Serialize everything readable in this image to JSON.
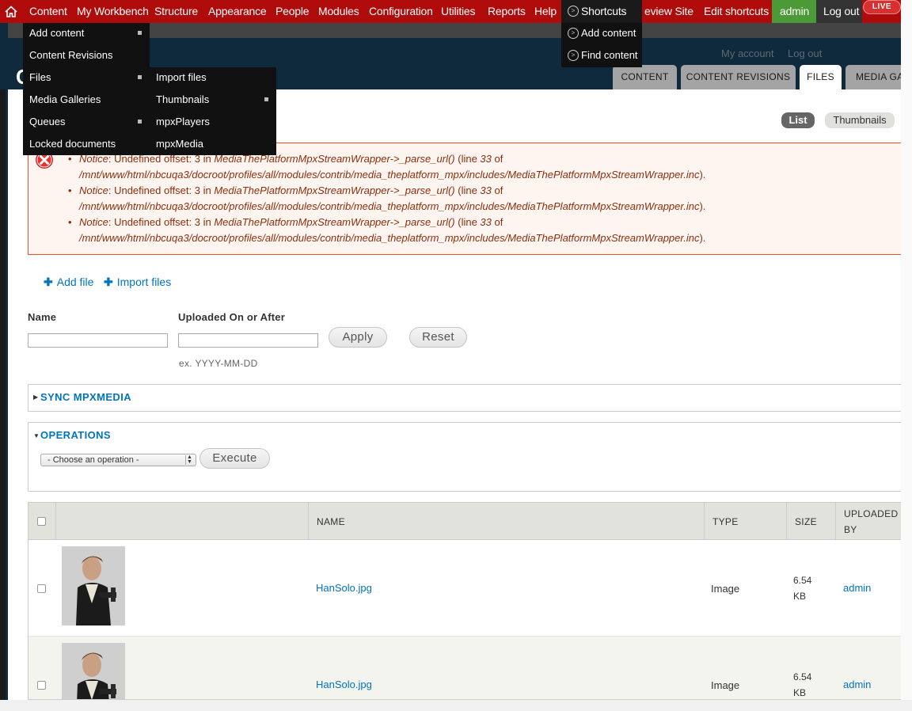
{
  "toolbar": {
    "items": [
      "Content",
      "My Workbench",
      "Structure",
      "Appearance",
      "People",
      "Modules",
      "Configuration",
      "Utilities",
      "Reports",
      "Help"
    ],
    "shortcuts_label": "Shortcuts",
    "preview_site": "eview Site",
    "edit_shortcuts": "Edit shortcuts",
    "user": "admin",
    "logout": "Log out",
    "live_badge": "LIVE"
  },
  "header": {
    "title_fragment": "C",
    "my_account": "My account",
    "log_out": "Log out"
  },
  "tabs": [
    "CONTENT",
    "CONTENT REVISIONS",
    "FILES",
    "MEDIA GA"
  ],
  "view_toggle": {
    "list": "List",
    "thumbnails": "Thumbnails"
  },
  "errors": [
    {
      "label": "Notice",
      "text": ": Undefined offset: 3 in ",
      "func": "MediaThePlatformMpxStreamWrapper->_parse_url()",
      "line_pre": " (line ",
      "line": "33",
      "line_post": " of",
      "path": "/mnt/www/html/nbcuqa3/docroot/profiles/all/modules/contrib/media_theplatform_mpx/includes/MediaThePlatformMpxStreamWrapper.inc",
      "end": ")."
    },
    {
      "label": "Notice",
      "text": ": Undefined offset: 3 in ",
      "func": "MediaThePlatformMpxStreamWrapper->_parse_url()",
      "line_pre": " (line ",
      "line": "33",
      "line_post": " of",
      "path": "/mnt/www/html/nbcuqa3/docroot/profiles/all/modules/contrib/media_theplatform_mpx/includes/MediaThePlatformMpxStreamWrapper.inc",
      "end": ")."
    },
    {
      "label": "Notice",
      "text": ": Undefined offset: 3 in ",
      "func": "MediaThePlatformMpxStreamWrapper->_parse_url()",
      "line_pre": " (line ",
      "line": "33",
      "line_post": " of",
      "path": "/mnt/www/html/nbcuqa3/docroot/profiles/all/modules/contrib/media_theplatform_mpx/includes/MediaThePlatformMpxStreamWrapper.inc",
      "end": ")."
    }
  ],
  "actions": {
    "add_file": "Add file",
    "import_files": "Import files"
  },
  "filters": {
    "name_label": "Name",
    "name_value": "",
    "date_label": "Uploaded On or After",
    "date_value": "",
    "date_hint": "ex. YYYY-MM-DD",
    "apply": "Apply",
    "reset": "Reset"
  },
  "sync_fieldset": {
    "legend": "SYNC MPXMEDIA",
    "collapsed": true
  },
  "operations": {
    "legend": "OPERATIONS",
    "select_value": "- Choose an operation -",
    "execute": "Execute"
  },
  "table": {
    "columns": [
      "NAME",
      "TYPE",
      "SIZE",
      "UPLOADED",
      "BY"
    ],
    "rows": [
      {
        "name": "HanSolo.jpg",
        "type": "Image",
        "size_num": "6.54",
        "size_unit": "KB",
        "uploaded_by": "admin"
      },
      {
        "name": "HanSolo.jpg",
        "type": "Image",
        "size_num": "6.54",
        "size_unit": "KB",
        "uploaded_by": "admin"
      }
    ]
  },
  "content_menu": {
    "items": [
      "Add content",
      "Content Revisions",
      "Files",
      "Media Galleries",
      "Queues",
      "Locked documents"
    ]
  },
  "files_submenu": {
    "items": [
      "Import files",
      "Thumbnails",
      "mpxPlayers",
      "mpxMedia"
    ]
  },
  "shortcuts_menu": {
    "items": [
      "Add content",
      "Find content"
    ]
  },
  "colors": {
    "toolbar": "#b00b0b",
    "link": "#0074bd",
    "error_text": "#8c2e0b",
    "error_border": "#ed541d",
    "admin_green": "#4c9a37"
  }
}
